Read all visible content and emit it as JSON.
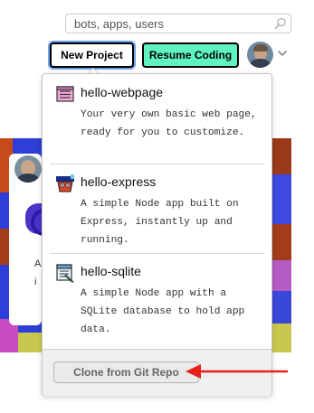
{
  "header": {
    "search": {
      "placeholder": "bots, apps, users",
      "icon": "search-icon"
    },
    "new_project_label": "New Project",
    "resume_coding_label": "Resume Coding",
    "resume_coding_color": "#5ef3c0",
    "focus_ring_color": "#6f9ff0",
    "avatar_icon": "user-avatar",
    "menu_toggle_icon": "chevron-down-icon"
  },
  "new_project_menu": {
    "items": [
      {
        "title": "hello-webpage",
        "description": "Your very own basic web page, ready for you to customize.",
        "icon": "webpage-icon"
      },
      {
        "title": "hello-express",
        "description": "A simple Node app built on Express, instantly up and running.",
        "icon": "express-icon"
      },
      {
        "title": "hello-sqlite",
        "description": "A simple Node app with a SQLite database to hold app data.",
        "icon": "sqlite-icon"
      }
    ],
    "clone_label": "Clone from Git Repo"
  },
  "annotation": {
    "arrow_color": "#e8201a",
    "arrow_icon": "red-arrow-left-icon"
  },
  "background": {
    "fragment_line_1": "A",
    "fragment_line_2": "i"
  }
}
